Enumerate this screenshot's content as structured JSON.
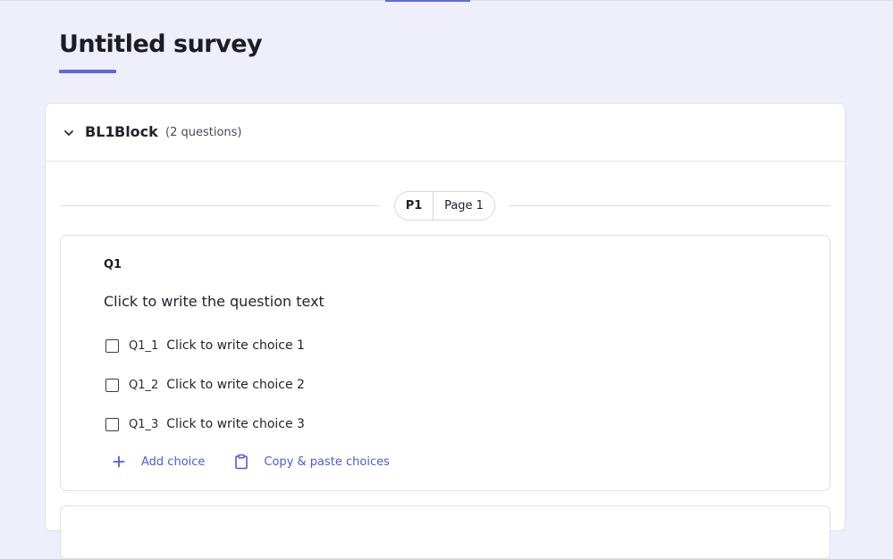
{
  "survey": {
    "title": "Untitled survey"
  },
  "block": {
    "id": "BL1",
    "name": "Block",
    "count": "(2 questions)"
  },
  "page": {
    "id": "P1",
    "name": "Page 1"
  },
  "question": {
    "label": "Q1",
    "text": "Click to write the question text",
    "choices": [
      {
        "id": "Q1_1",
        "text": "Click to write choice 1"
      },
      {
        "id": "Q1_2",
        "text": "Click to write choice 2"
      },
      {
        "id": "Q1_3",
        "text": "Click to write choice 3"
      }
    ]
  },
  "actions": {
    "add_choice": "Add choice",
    "copy_paste": "Copy & paste choices"
  },
  "icons": {
    "collapse": "chevron-down-icon",
    "add": "plus-icon",
    "clipboard": "clipboard-icon"
  },
  "colors": {
    "accent": "#5b67e6",
    "link": "#4f5bd5",
    "background": "#eeeffb"
  }
}
